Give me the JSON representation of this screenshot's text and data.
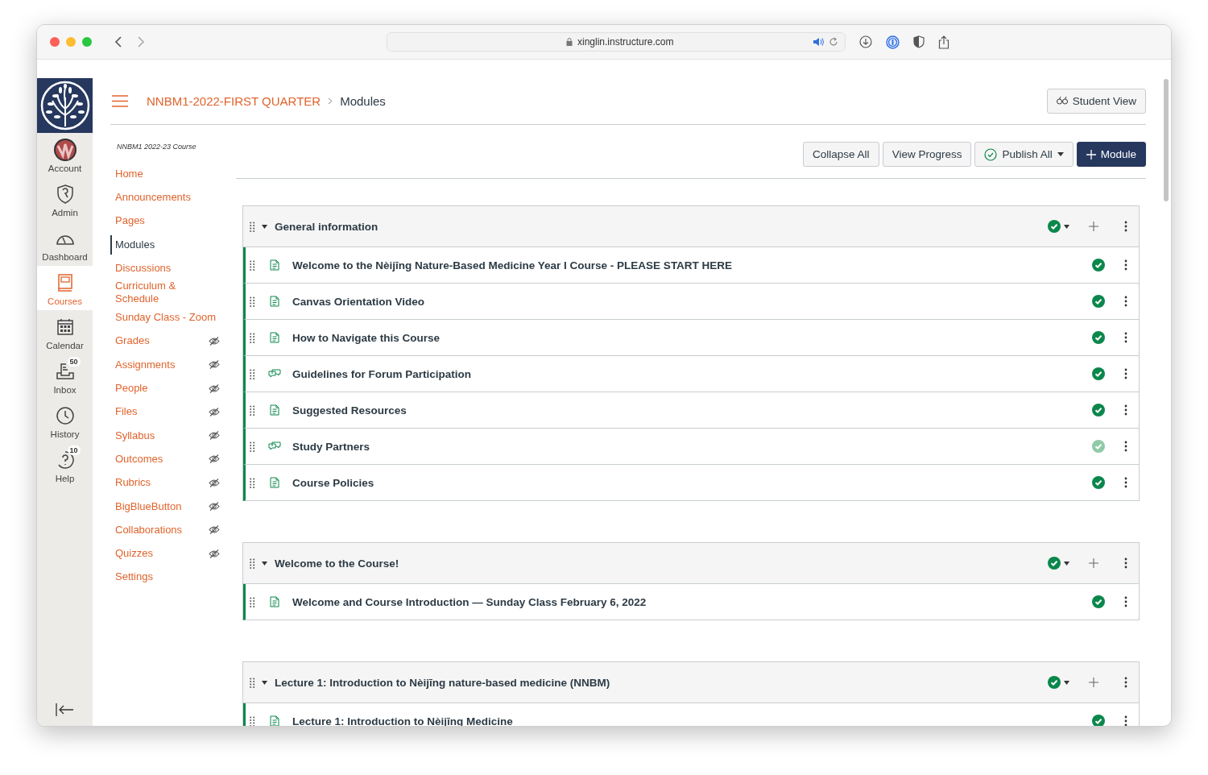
{
  "browser": {
    "url": "xinglin.instructure.com"
  },
  "global_nav": [
    {
      "label": "Account",
      "selected": false
    },
    {
      "label": "Admin",
      "selected": false
    },
    {
      "label": "Dashboard",
      "selected": false
    },
    {
      "label": "Courses",
      "selected": true
    },
    {
      "label": "Calendar",
      "selected": false
    },
    {
      "label": "Inbox",
      "selected": false,
      "badge": "50"
    },
    {
      "label": "History",
      "selected": false
    },
    {
      "label": "Help",
      "selected": false,
      "badge": "10"
    }
  ],
  "breadcrumb": {
    "course": "NNBM1-2022-FIRST QUARTER",
    "current": "Modules"
  },
  "student_view": "Student View",
  "course_label": "NNBM1 2022-23 Course",
  "course_nav": [
    {
      "label": "Home",
      "selected": false,
      "hidden": false
    },
    {
      "label": "Announcements",
      "selected": false,
      "hidden": false
    },
    {
      "label": "Pages",
      "selected": false,
      "hidden": false
    },
    {
      "label": "Modules",
      "selected": true,
      "hidden": false
    },
    {
      "label": "Discussions",
      "selected": false,
      "hidden": false
    },
    {
      "label": "Curriculum & Schedule",
      "selected": false,
      "hidden": false
    },
    {
      "label": "Sunday Class - Zoom",
      "selected": false,
      "hidden": false
    },
    {
      "label": "Grades",
      "selected": false,
      "hidden": true
    },
    {
      "label": "Assignments",
      "selected": false,
      "hidden": true
    },
    {
      "label": "People",
      "selected": false,
      "hidden": true
    },
    {
      "label": "Files",
      "selected": false,
      "hidden": true
    },
    {
      "label": "Syllabus",
      "selected": false,
      "hidden": true
    },
    {
      "label": "Outcomes",
      "selected": false,
      "hidden": true
    },
    {
      "label": "Rubrics",
      "selected": false,
      "hidden": true
    },
    {
      "label": "BigBlueButton",
      "selected": false,
      "hidden": true
    },
    {
      "label": "Collaborations",
      "selected": false,
      "hidden": true
    },
    {
      "label": "Quizzes",
      "selected": false,
      "hidden": true
    },
    {
      "label": "Settings",
      "selected": false,
      "hidden": false
    }
  ],
  "toolbar": {
    "collapse_all": "Collapse All",
    "view_progress": "View Progress",
    "publish_all": "Publish All",
    "add_module": "Module"
  },
  "modules": [
    {
      "title": "General information",
      "expanded": true,
      "published": true,
      "items": [
        {
          "title": "Welcome to the Nèijīng Nature-Based Medicine Year I Course - PLEASE START HERE",
          "kind": "page",
          "published": true,
          "faded": false
        },
        {
          "title": "Canvas Orientation Video",
          "kind": "page",
          "published": true,
          "faded": false
        },
        {
          "title": "How to Navigate this Course",
          "kind": "page",
          "published": true,
          "faded": false
        },
        {
          "title": "Guidelines for Forum Participation",
          "kind": "discussion",
          "published": true,
          "faded": false
        },
        {
          "title": "Suggested Resources",
          "kind": "page",
          "published": true,
          "faded": false
        },
        {
          "title": "Study Partners",
          "kind": "discussion",
          "published": true,
          "faded": true
        },
        {
          "title": "Course Policies",
          "kind": "page",
          "published": true,
          "faded": false
        }
      ]
    },
    {
      "title": "Welcome to the Course!",
      "expanded": true,
      "published": true,
      "items": [
        {
          "title": "Welcome and Course Introduction — Sunday Class February 6, 2022",
          "kind": "page",
          "published": true,
          "faded": false
        }
      ]
    },
    {
      "title": "Lecture 1: Introduction to Nèijīng nature-based medicine (NNBM)",
      "expanded": true,
      "published": true,
      "items": [
        {
          "title": "Lecture 1: Introduction to Nèijīng Medicine",
          "kind": "page",
          "published": true,
          "faded": false
        }
      ]
    }
  ]
}
